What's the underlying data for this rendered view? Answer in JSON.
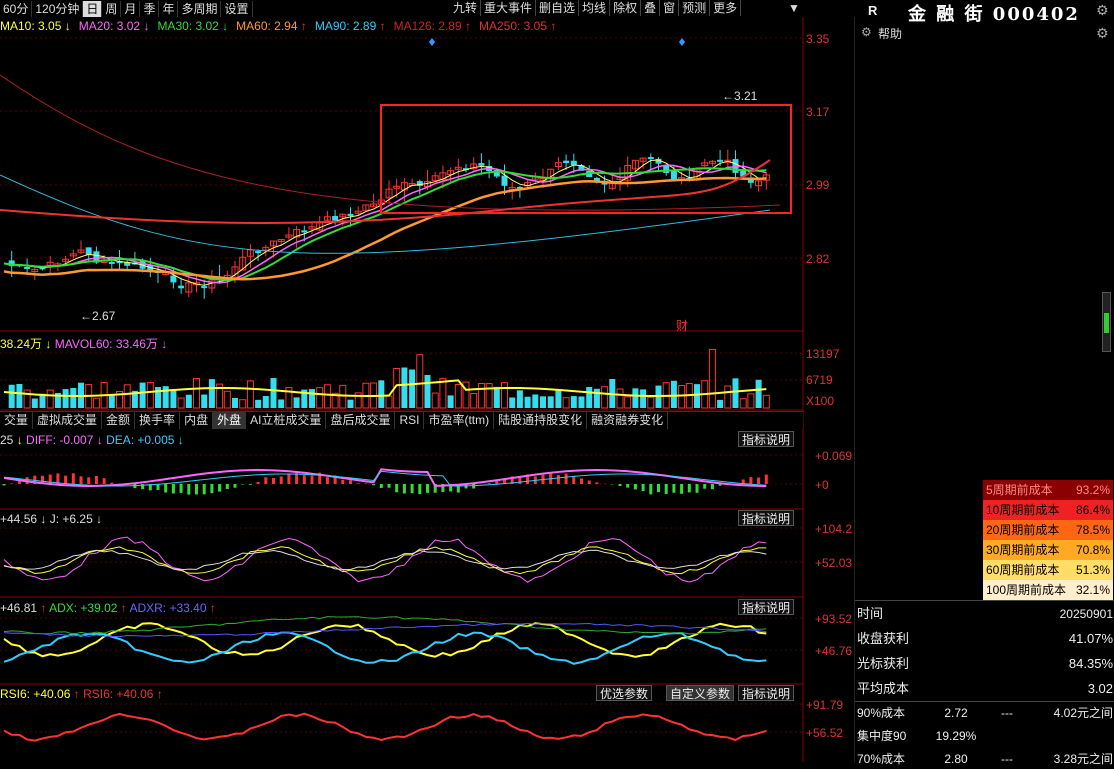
{
  "topbar": {
    "periods": [
      "60分",
      "120分钟",
      "日",
      "周",
      "月",
      "季",
      "年",
      "多周期",
      "设置"
    ],
    "active_period": "日",
    "tools": [
      "九转",
      "重大事件",
      "删自选",
      "均线",
      "除权",
      "叠",
      "窗",
      "预测",
      "更多"
    ]
  },
  "stock": {
    "flag": "R",
    "title": "金 融 街 000402"
  },
  "ma_legend": [
    {
      "text": "MA10: 3.05",
      "arrow": "↓",
      "color": "#ffff33"
    },
    {
      "text": "MA20: 3.02",
      "arrow": "↓",
      "color": "#ff66ff"
    },
    {
      "text": "MA30: 3.02",
      "arrow": "↓",
      "color": "#33dd33"
    },
    {
      "text": "MA60: 2.94",
      "arrow": "↑",
      "color": "#ff9933"
    },
    {
      "text": "MA90: 2.89",
      "arrow": "↑",
      "color": "#33ccff"
    },
    {
      "text": "MA126: 2.89",
      "arrow": "↑",
      "color": "#cc2222"
    },
    {
      "text": "MA250: 3.05",
      "arrow": "↑",
      "color": "#dd3333"
    }
  ],
  "price_axis": [
    "3.35",
    "3.17",
    "2.99",
    "2.82"
  ],
  "annotations": {
    "high": "3.21",
    "low": "2.67",
    "cai": "财"
  },
  "volume": {
    "legend1": "38.24万",
    "legend2": "MAVOL60: 33.46万",
    "axis": [
      "13197",
      "6719",
      "X100"
    ]
  },
  "indicator_tabs": [
    "交量",
    "虚拟成交量",
    "金额",
    "换手率",
    "内盘",
    "外盘",
    "AI立桩成交量",
    "盘后成交量",
    "RSI",
    "市盈率(ttm)",
    "陆股通持股变化",
    "融资融券变化"
  ],
  "active_indicator_tab": "外盘",
  "explain_label": "指标说明",
  "macd": {
    "legend": [
      "25",
      "DIFF: -0.007",
      "DEA: +0.005"
    ],
    "axis": [
      "+0.069",
      "+0"
    ]
  },
  "kdj": {
    "legend": [
      "+44.56",
      "J: +6.25"
    ],
    "axis": [
      "+104.2",
      "+52.03"
    ]
  },
  "dmi": {
    "legend": [
      "+46.81",
      "ADX: +39.02",
      "ADXR: +33.40"
    ],
    "axis": [
      "+93.52",
      "+46.76"
    ]
  },
  "rsi": {
    "legend": [
      "RSI6: +40.06",
      "RSI6: +40.06"
    ],
    "axis": [
      "+91.79",
      "+56.52"
    ],
    "buttons": [
      "优选参数",
      "自定义参数"
    ]
  },
  "chip": {
    "help": "帮助",
    "cost_rows": [
      {
        "label": "5周期前成本",
        "value": "93.2%",
        "bg": "#8b0000",
        "color": "#f88"
      },
      {
        "label": "10周期前成本",
        "value": "86.4%",
        "bg": "#ee2222",
        "color": "#000"
      },
      {
        "label": "20周期前成本",
        "value": "78.5%",
        "bg": "#ff6611",
        "color": "#000"
      },
      {
        "label": "30周期前成本",
        "value": "70.8%",
        "bg": "#ffaa22",
        "color": "#000"
      },
      {
        "label": "60周期前成本",
        "value": "51.3%",
        "bg": "#ffdd66",
        "color": "#000"
      },
      {
        "label": "100周期前成本",
        "value": "32.1%",
        "bg": "#ffeecc",
        "color": "#000"
      }
    ],
    "stats": [
      {
        "label": "时间",
        "value": "20250901"
      },
      {
        "label": "收盘获利",
        "value": "41.07%"
      },
      {
        "label": "光标获利",
        "value": "84.35%"
      },
      {
        "label": "平均成本",
        "value": "3.02"
      }
    ],
    "ranges": [
      {
        "label": "90%成本",
        "a": "2.72",
        "sep": "---",
        "b": "4.02元之间"
      },
      {
        "label": "集中度90",
        "a": "19.29%",
        "sep": "",
        "b": ""
      },
      {
        "label": "70%成本",
        "a": "2.80",
        "sep": "---",
        "b": "3.28元之间"
      }
    ]
  }
}
